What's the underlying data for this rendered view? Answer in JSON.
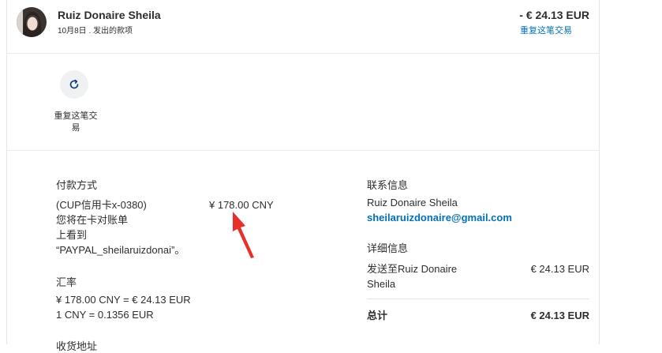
{
  "header": {
    "name": "Ruiz Donaire Sheila",
    "subline": "10月8日 . 发出的款项",
    "amount": "- € 24.13 EUR",
    "repeat_link": "重复这笔交易"
  },
  "actions": {
    "repeat_label": "重复这笔交\n易"
  },
  "payment": {
    "heading": "付款方式",
    "method_lines": [
      "(CUP信用卡x-0380)",
      "您将在卡对账单",
      "上看到",
      "“PAYPAL_sheilaruizdonai”。"
    ],
    "method_amount": "¥ 178.00 CNY"
  },
  "exchange": {
    "heading": "汇率",
    "line1": "¥ 178.00 CNY = € 24.13 EUR",
    "line2": "1 CNY = 0.1356 EUR"
  },
  "shipping": {
    "heading": "收货地址"
  },
  "contact": {
    "heading": "联系信息",
    "name": "Ruiz Donaire Sheila",
    "email": "sheilaruizdonaire@gmail.com"
  },
  "details": {
    "heading": "详细信息",
    "sent_to": "发送至Ruiz Donaire\nSheila",
    "sent_amount": "€ 24.13 EUR",
    "total_label": "总计",
    "total_amount": "€ 24.13 EUR"
  },
  "icons": {
    "repeat": "refresh-icon",
    "annotation": "red-arrow"
  },
  "colors": {
    "link": "#0070ba",
    "arrow": "#e8302a"
  }
}
